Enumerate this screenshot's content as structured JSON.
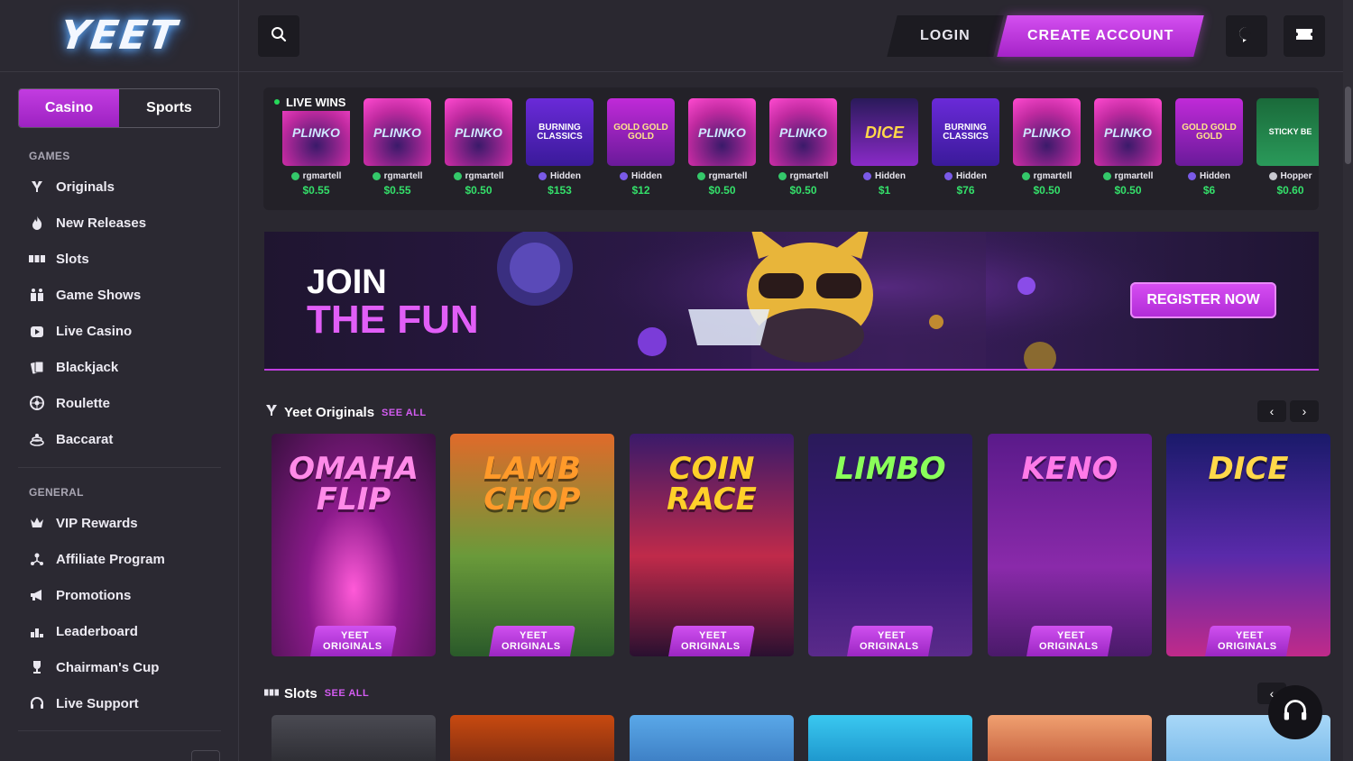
{
  "brand": {
    "logo": "YEET"
  },
  "sidebar": {
    "switch": {
      "casino": "Casino",
      "sports": "Sports"
    },
    "games_label": "GAMES",
    "games": [
      {
        "label": "Originals",
        "icon": "originals-icon"
      },
      {
        "label": "New Releases",
        "icon": "flame-icon"
      },
      {
        "label": "Slots",
        "icon": "slots-icon"
      },
      {
        "label": "Game Shows",
        "icon": "game-shows-icon"
      },
      {
        "label": "Live Casino",
        "icon": "live-casino-icon"
      },
      {
        "label": "Blackjack",
        "icon": "cards-icon"
      },
      {
        "label": "Roulette",
        "icon": "roulette-icon"
      },
      {
        "label": "Baccarat",
        "icon": "baccarat-icon"
      }
    ],
    "general_label": "GENERAL",
    "general": [
      {
        "label": "VIP Rewards",
        "icon": "crown-icon"
      },
      {
        "label": "Affiliate Program",
        "icon": "affiliate-icon"
      },
      {
        "label": "Promotions",
        "icon": "megaphone-icon"
      },
      {
        "label": "Leaderboard",
        "icon": "leaderboard-icon"
      },
      {
        "label": "Chairman's Cup",
        "icon": "trophy-icon"
      },
      {
        "label": "Live Support",
        "icon": "headset-icon"
      }
    ]
  },
  "header": {
    "login": "LOGIN",
    "create_account": "CREATE ACCOUNT"
  },
  "live_wins": {
    "label": "LIVE WINS",
    "items": [
      {
        "game": "PLINKO",
        "user": "rgmartell",
        "amount": "$0.55"
      },
      {
        "game": "PLINKO",
        "user": "rgmartell",
        "amount": "$0.55"
      },
      {
        "game": "PLINKO",
        "user": "rgmartell",
        "amount": "$0.50"
      },
      {
        "game": "BURNING CLASSICS",
        "user": "Hidden",
        "amount": "$153"
      },
      {
        "game": "GOLD GOLD GOLD",
        "user": "Hidden",
        "amount": "$12"
      },
      {
        "game": "PLINKO",
        "user": "rgmartell",
        "amount": "$0.50"
      },
      {
        "game": "PLINKO",
        "user": "rgmartell",
        "amount": "$0.50"
      },
      {
        "game": "DICE",
        "user": "Hidden",
        "amount": "$1"
      },
      {
        "game": "BURNING CLASSICS",
        "user": "Hidden",
        "amount": "$76"
      },
      {
        "game": "PLINKO",
        "user": "rgmartell",
        "amount": "$0.50"
      },
      {
        "game": "PLINKO",
        "user": "rgmartell",
        "amount": "$0.50"
      },
      {
        "game": "GOLD GOLD GOLD",
        "user": "Hidden",
        "amount": "$6"
      },
      {
        "game": "STICKY BE",
        "user": "Hopper",
        "amount": "$0.60"
      }
    ]
  },
  "banner": {
    "line1": "JOIN",
    "line2": "THE FUN",
    "cta": "REGISTER NOW"
  },
  "originals": {
    "title": "Yeet Originals",
    "see_all": "SEE ALL",
    "games": [
      {
        "title": "OMAHA FLIP",
        "tag1": "YEET",
        "tag2": "ORIGINALS"
      },
      {
        "title": "LAMB CHOP",
        "tag1": "YEET",
        "tag2": "ORIGINALS"
      },
      {
        "title": "COIN RACE",
        "tag1": "YEET",
        "tag2": "ORIGINALS"
      },
      {
        "title": "LIMBO",
        "tag1": "YEET",
        "tag2": "ORIGINALS"
      },
      {
        "title": "KENO",
        "tag1": "YEET",
        "tag2": "ORIGINALS"
      },
      {
        "title": "DICE",
        "tag1": "YEET",
        "tag2": "ORIGINALS"
      }
    ]
  },
  "slots": {
    "title": "Slots",
    "see_all": "SEE ALL"
  },
  "colors": {
    "accent": "#c33ee2",
    "win_green": "#34e06a",
    "bg": "#2a2830"
  }
}
